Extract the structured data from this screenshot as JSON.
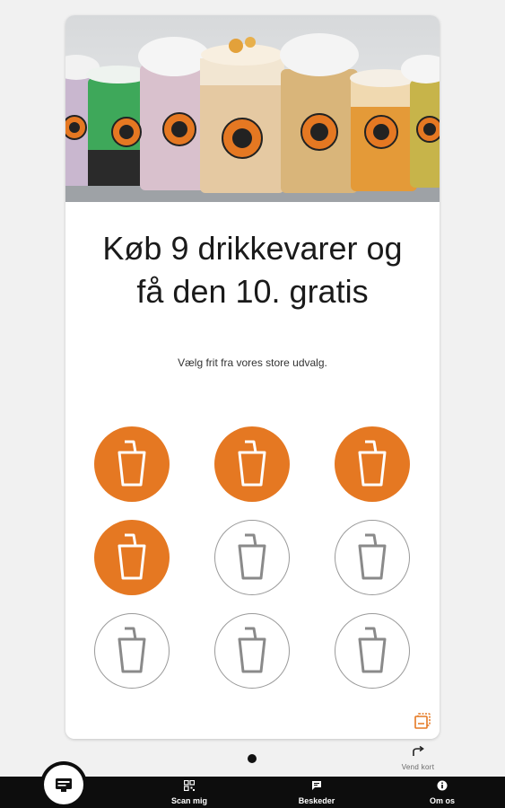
{
  "card": {
    "title_line1": "Køb 9 drikkevarer og",
    "title_line2": "få den 10. gratis",
    "subtitle": "Vælg frit fra vores store udvalg."
  },
  "stamps": {
    "total": 9,
    "filled": 4,
    "accent_color": "#e57822",
    "icon": "drink-cup-icon"
  },
  "flip_card": {
    "label": "Vend kort",
    "icon": "flip-arrow-icon"
  },
  "bottom_nav": {
    "items": [
      {
        "label": "",
        "icon": "loyalty-card-icon"
      },
      {
        "label": "Scan mig",
        "icon": "qr-code-icon"
      },
      {
        "label": "Beskeder",
        "icon": "message-icon"
      },
      {
        "label": "Om os",
        "icon": "info-icon"
      }
    ]
  }
}
